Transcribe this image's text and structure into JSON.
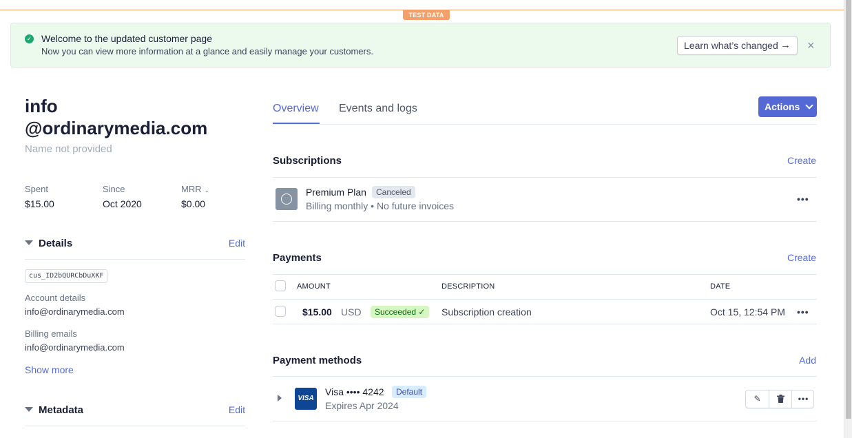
{
  "env_badge": "TEST DATA",
  "banner": {
    "title": "Welcome to the updated customer page",
    "description": "Now you can view more information at a glance and easily manage your customers.",
    "learn_button": "Learn what’s changed",
    "learn_arrow": "→",
    "close": "×"
  },
  "customer": {
    "email_line1": "info",
    "email_line2": "@ordinarymedia.com",
    "name": "Name not provided",
    "stats": [
      {
        "label": "Spent",
        "value": "$15.00"
      },
      {
        "label": "Since",
        "value": "Oct 2020"
      },
      {
        "label": "MRR",
        "value": "$0.00"
      }
    ]
  },
  "details": {
    "title": "Details",
    "edit": "Edit",
    "customer_id": "cus_ID2bQURCbDuXKF",
    "account_label": "Account details",
    "account_value": "info@ordinarymedia.com",
    "billing_label": "Billing emails",
    "billing_value": "info@ordinarymedia.com",
    "show_more": "Show more"
  },
  "metadata": {
    "title": "Metadata",
    "edit": "Edit"
  },
  "tabs": {
    "overview": "Overview",
    "events": "Events and logs"
  },
  "actions_label": "Actions",
  "subscriptions": {
    "title": "Subscriptions",
    "create": "Create",
    "plan_name": "Premium Plan",
    "status": "Canceled",
    "subtitle": "Billing monthly • No future invoices",
    "more": "•••"
  },
  "payments": {
    "title": "Payments",
    "create": "Create",
    "columns": {
      "amount": "AMOUNT",
      "description": "DESCRIPTION",
      "date": "DATE"
    },
    "rows": [
      {
        "amount": "$15.00",
        "currency": "USD",
        "status": "Succeeded ✓",
        "description": "Subscription creation",
        "date": "Oct 15, 12:54 PM",
        "more": "•••"
      }
    ]
  },
  "payment_methods": {
    "title": "Payment methods",
    "add": "Add",
    "card": {
      "brand_logo": "VISA",
      "label": "Visa •••• 4242",
      "badge": "Default",
      "expires": "Expires Apr 2024"
    },
    "buttons": {
      "edit": "✎",
      "delete": "🗑",
      "more": "•••"
    }
  },
  "colors": {
    "accent": "#556cd6",
    "primary_button": "#5469d4",
    "banner_bg": "#ecfaee",
    "test_badge": "#f5a06a",
    "success": "#1ea672"
  }
}
